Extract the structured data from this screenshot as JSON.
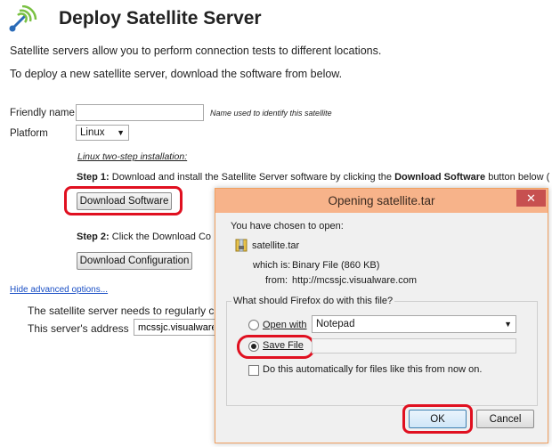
{
  "page": {
    "title": "Deploy Satellite Server",
    "intro_1": "Satellite servers allow you to perform connection tests to different locations.",
    "intro_2": "To deploy a new satellite server, download the software from below.",
    "friendly_name_label": "Friendly name",
    "friendly_name_value": "",
    "friendly_name_hint": "Name used to identify this satellite",
    "platform_label": "Platform",
    "platform_value": "Linux",
    "install_heading": "Linux two-step installation:",
    "step1_prefix": "Step 1:",
    "step1_text": " Download and install the Satellite Server software by clicking the ",
    "step1_bold": "Download Software",
    "step1_suffix": " button below (",
    "download_software_button": "Download Software",
    "step2_prefix": "Step 2:",
    "step2_text": " Click the Download Co",
    "download_config_button": "Download Configuration",
    "hide_advanced_link": "Hide advanced options...",
    "advanced_text": "The satellite server needs to regularly c",
    "server_address_label": "This server's address",
    "server_address_value": "mcssjc.visualware."
  },
  "dialog": {
    "title": "Opening satellite.tar",
    "close_glyph": "✕",
    "chosen_text": "You have chosen to open:",
    "file_name": "satellite.tar",
    "which_is_label": "which is:",
    "which_is_value": "Binary File (860 KB)",
    "from_label": "from:",
    "from_value": "http://mcssjc.visualware.com",
    "question": "What should Firefox do with this file?",
    "open_with_label": "Open with",
    "open_with_app": "Notepad",
    "save_file_label": "Save File",
    "auto_label": "Do this automatically for files like this from now on.",
    "ok_button": "OK",
    "cancel_button": "Cancel"
  },
  "state": {
    "selected_action": "Save File",
    "auto_checked": false
  },
  "colors": {
    "highlight_ring": "#e01020",
    "dialog_titlebar": "#f7b38a",
    "close_button": "#c75050",
    "link": "#1a4fc5"
  }
}
